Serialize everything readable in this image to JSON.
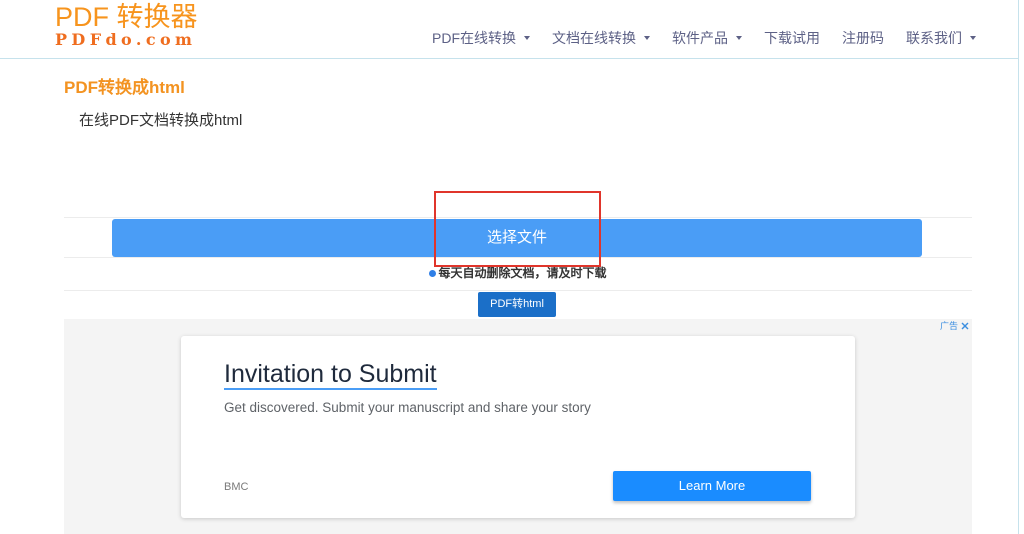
{
  "header": {
    "logo_main": "PDF 转换器",
    "logo_sub": "PDFdo.com",
    "nav": [
      {
        "label": "PDF在线转换",
        "dropdown": true
      },
      {
        "label": "文档在线转换",
        "dropdown": true
      },
      {
        "label": "软件产品",
        "dropdown": true
      },
      {
        "label": "下载试用",
        "dropdown": false
      },
      {
        "label": "注册码",
        "dropdown": false
      },
      {
        "label": "联系我们",
        "dropdown": true
      }
    ]
  },
  "converter": {
    "title": "PDF转换成html",
    "subtitle": "在线PDF文档转换成html",
    "select_file_label": "选择文件",
    "notice": "每天自动删除文档，请及时下载",
    "convert_button_label": "PDF转html"
  },
  "ad": {
    "marker": "广告",
    "headline": "Invitation to Submit",
    "body": "Get discovered. Submit your manuscript and share your story",
    "advertiser": "BMC",
    "cta_label": "Learn More"
  },
  "icons": {
    "nav_dropdown": "caret-down-icon",
    "notice_bullet": "radio-dot-icon",
    "ad_close": "close-icon"
  },
  "colors": {
    "brand_orange": "#f7941d",
    "nav_text": "#5d6186",
    "select_button": "#4a9df6",
    "convert_button": "#1b6fc8",
    "ad_cta": "#1a8cff",
    "highlight_outline": "#e0352b"
  }
}
